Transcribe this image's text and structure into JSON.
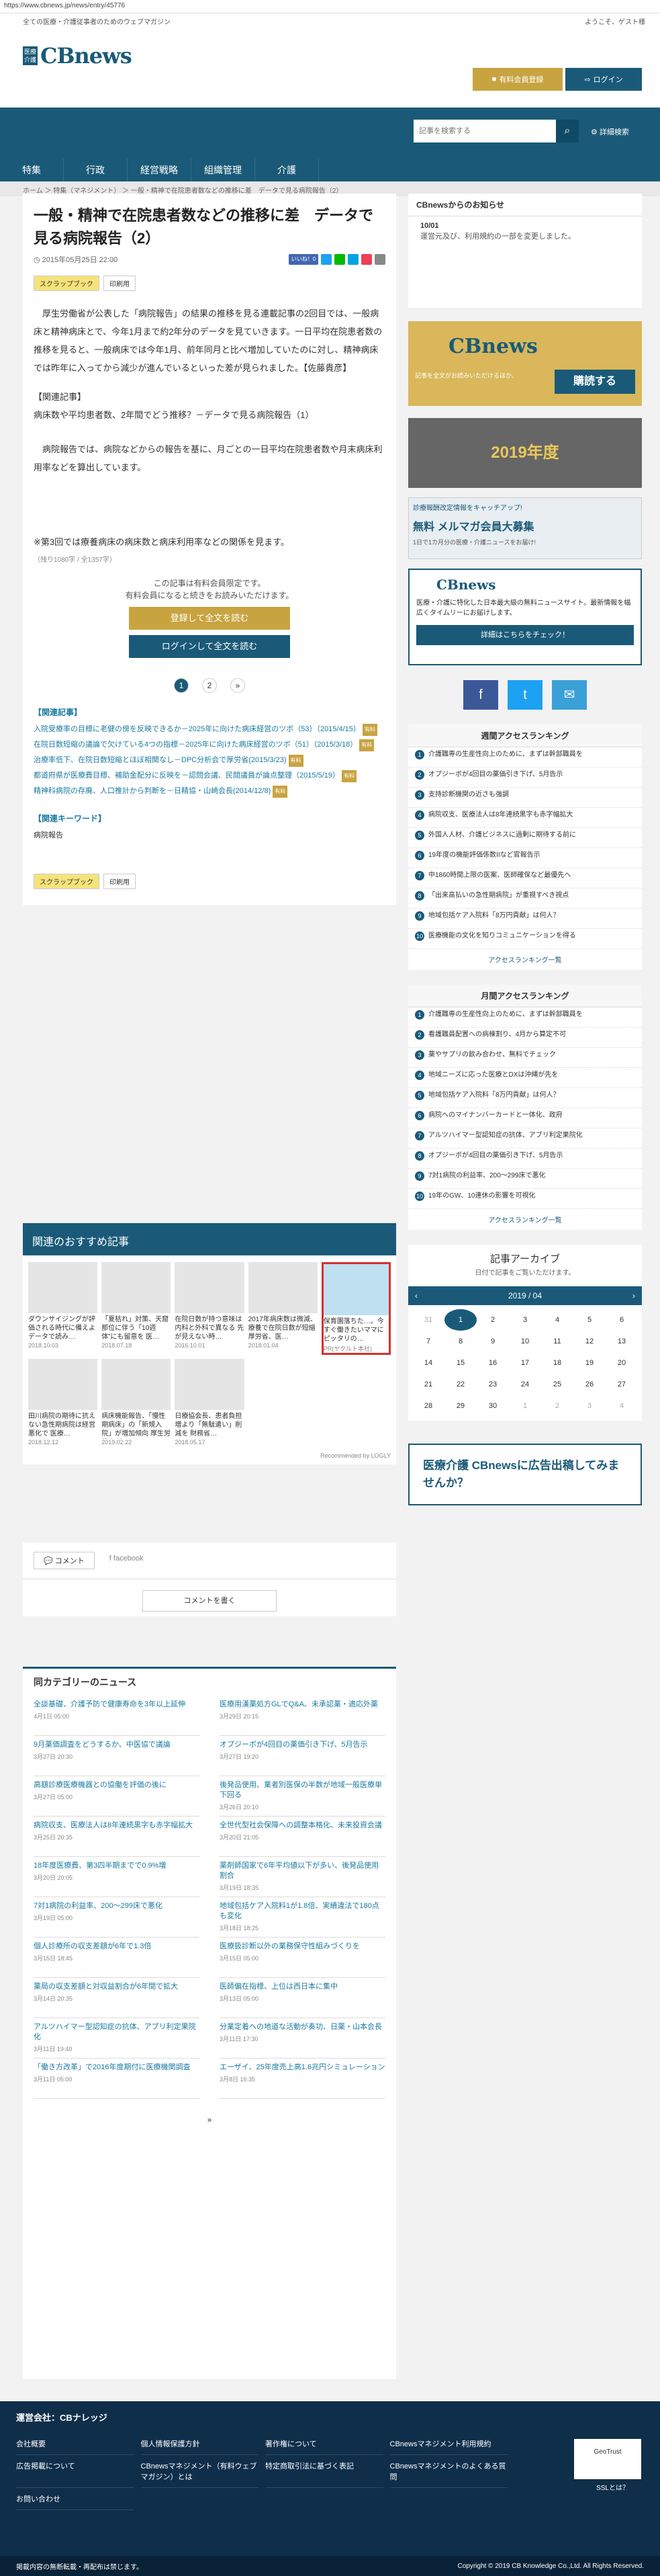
{
  "url": "https://www.cbnews.jp/news/entry/45776",
  "tagline": "全ての医療・介護従事者のためのウェブマガジン",
  "welcome": "ようこそ、ゲスト様",
  "logo": {
    "kanji": "医療介護",
    "cb": "CBnews",
    "mag": "マネジメント"
  },
  "header": {
    "register": "有料会員登録",
    "login": "ログイン"
  },
  "search": {
    "placeholder": "記事を検索する",
    "advanced": "詳細検索"
  },
  "nav": [
    "特集",
    "行政",
    "経営戦略",
    "組織管理",
    "介護"
  ],
  "breadcrumb": "ホーム ＞ 特集（マネジメント） ＞ 一般・精神で在院患者数などの推移に差　データで見る病院報告（2）",
  "article": {
    "title": "一般・精神で在院患者数などの推移に差　データで見る病院報告（2）",
    "date": "2015年05月25日 22:00",
    "like": "いいね！0",
    "scrap": "スクラップブック",
    "print": "印刷用",
    "p1": "厚生労働省が公表した「病院報告」の結果の推移を見る連載記事の2回目では、一般病床と精神病床とで、今年1月まで約2年分のデータを見ていきます。一日平均在院患者数の推移を見ると、一般病床では今年1月、前年同月と比べ増加していたのに対し、精神病床では昨年に入ってから減少が進んでいるといった差が見られました。【佐藤貴彦】",
    "related_head": "【関連記事】",
    "related_link": "病床数や平均患者数、2年間でどう推移？－データで見る病院報告（1）",
    "p2": "病院報告では、病院などからの報告を基に、月ごとの一日平均在院患者数や月末病床利用率などを算出しています。",
    "p3": "※第3回では療養病床の病床数と病床利用率などの関係を見ます。",
    "charcount": "（残り1080字 / 全1357字）",
    "paywall1": "この記事は有料会員限定です。",
    "paywall2": "有料会員になると続きをお読みいただけます。",
    "btn_register": "登録して全文を読む",
    "btn_login": "ログインして全文を読む",
    "pages": [
      "1",
      "2",
      "»"
    ],
    "kanren_head": "【関連記事】",
    "kanren": [
      "入院受療率の目標に老健の傍を反映できるか－2025年に向けた病床経営のツボ（53）（2015/4/15）",
      "在院日数短縮の議論で欠けている4つの指標－2025年に向けた病床経営のツボ（51）（2015/3/18）",
      "治療率低下、在院日数短縮とほぼ相関なし－DPC分析会で厚労省(2015/3/23)",
      "都道府県が医療費目標、補助金配分に反映を－認問会議、民間議員が論点整理（2015/5/19）",
      "精神科病院の存廃、人口推計から判断を－日精協・山崎会長(2014/12/8)"
    ],
    "kw_head": "【関連キーワード】",
    "kw": "病院報告",
    "badge": "有料"
  },
  "recommend": {
    "head": "関連のおすすめ記事",
    "cards": [
      {
        "cap": "ダウンサイジングが評価される時代に備えよ データで読み…",
        "date": "2018.10.03"
      },
      {
        "cap": "「夏枯れ」対策、天窟那位に伴う「10週体”にも留意を 医…",
        "date": "2018.07.18"
      },
      {
        "cap": "在院日数が持つ意味は内科と外科で異なる 先が見えない時…",
        "date": "2016.10.01"
      },
      {
        "cap": "2017年病床数は微減、療養で在院日数が短縮 厚労省、医…",
        "date": "2018.01.04"
      },
      {
        "cap": "保育園落ちた…。今すぐ働きたいママにピッタリの…",
        "date": "PR(ヤクルト本社)"
      },
      {
        "cap": "田川病院の期待に抗えない急性期病院は経営悪化で 医療…",
        "date": "2018.12.12"
      },
      {
        "cap": "病床機能報告、「慢性期病床」の「新規入院」が増加傾向 厚生労働省が…",
        "date": "2019.02.22"
      },
      {
        "cap": "日療協会長、患者負担増より「無駄遣い」削減を 財務省…",
        "date": "2018.05.17"
      },
      {
        "cap": "",
        "date": ""
      },
      {
        "cap": "",
        "date": ""
      }
    ],
    "powered": "Recommended by LOGLY"
  },
  "comments": {
    "tab1": "コメント",
    "tab2": "facebook",
    "btn": "コメントを書く"
  },
  "category": {
    "head": "同カテゴリーのニュース",
    "items": [
      {
        "t": "全談基礎、介護予防で健康寿命を3年以上延伸",
        "d": "4月1日 05:00"
      },
      {
        "t": "医療用漢薬処方GLでQ&A、未承認薬・適応外薬",
        "d": "3月29日 20:15"
      },
      {
        "t": "9月薬価調査をどうするか、中医協で議論",
        "d": "3月27日 20:30"
      },
      {
        "t": "オプジーボが4回目の薬価引き下げ、5月告示",
        "d": "3月27日 19:20"
      },
      {
        "t": "高額診療医療機器との協働を評価の後に",
        "d": "3月27日 05:00"
      },
      {
        "t": "後発品使用、業者別医保の半数が地域一般医療単下回る",
        "d": "3月26日 20:10"
      },
      {
        "t": "病院収支、医療法人は8年連続黒字も赤字幅拡大",
        "d": "3月25日 20:35"
      },
      {
        "t": "全世代型社会保障への調整本格化、未来投資会議",
        "d": "3月20日 21:05"
      },
      {
        "t": "18年度医療費、第3四半期までで0.9%増",
        "d": "3月20日 20:05"
      },
      {
        "t": "薬剤師国家で6年平均値以下が多い、後発品使用割合",
        "d": "3月19日 18:35"
      },
      {
        "t": "7対1病院の利益率、200～299床で悪化",
        "d": "3月19日 05:00"
      },
      {
        "t": "地域包括ケア入院料1が1.8倍、実績違法で180点も変化",
        "d": "3月18日 18:25"
      },
      {
        "t": "個人診療所の収支差額が6年で1.3倍",
        "d": "3月15日 18:45"
      },
      {
        "t": "医療扱診断以外の業務保守性組みづくりを",
        "d": "3月15日 05:00"
      },
      {
        "t": "薬局の収支差額と対収益割合が6年間で拡大",
        "d": "3月14日 20:35"
      },
      {
        "t": "医師偏在指標、上位は西日本に集中",
        "d": "3月13日 05:00"
      },
      {
        "t": "アルツハイマー型認知症の抗体、アブリ利定果院化",
        "d": "3月11日 19:40"
      },
      {
        "t": "分業定着への地道な活動が奏功、日薬・山本会長",
        "d": "3月11日 17:30"
      },
      {
        "t": "「働き方改革」で2016年度期付に医療機関調査",
        "d": "3月11日 05:00"
      },
      {
        "t": "エーザイ、25年度売上高1.6兆円シミュレーション",
        "d": "3月8日 16:35"
      }
    ],
    "page": "»"
  },
  "side": {
    "notice_head": "CBnewsからのお知らせ",
    "notice_date": "10/01",
    "notice_text": "運営元及び、利用規約の一部を変更しました。",
    "banner1_line1": "記事を全文がお読みいただけるほか、",
    "banner1_btn": "購読する",
    "banner2": "2019年度",
    "banner3_head": "診療報酬改定情報をキャッチアップ!",
    "banner3_main": "無料 メルマガ会員大募集",
    "banner3_sub": "1日で1カ月分の医療・介護ニュースをお届け!",
    "about_line": "医療・介護に特化した日本最大級の無料ニュースサイト。最新情報を幅広くタイムリーにお届けします。",
    "about_btn": "詳細はこちらをチェック！",
    "weekly_head": "週間アクセスランキング",
    "weekly": [
      "介護職専の生産性向上のために、まずは幹部職員を",
      "オプジーボが4回目の薬価引き下げ、5月告示",
      "支持診断機関の近さも強調",
      "病院収支、医療法人は8年連続黒字も赤字幅拡大",
      "外国人人材、介護ビジネスに過剰に期待する前に",
      "19年度の機能評価係数IIなど官報告示",
      "中1860時間上限の医案、医師確保など最優先へ",
      "「出来高払いの急性期病院」が重視すべき視点",
      "地域包括ケア入院料「8万円貢献」は何人？",
      "医療機能の文化を知りコミュニケーションを得る"
    ],
    "monthly_head": "月間アクセスランキング",
    "monthly": [
      "介護職専の生産性向上のために、まずは幹部職員を",
      "看護職員配置への病棟割り、4月から算定不可",
      "薬やサプリの飲み合わせ、無料でチェック",
      "地域ニーズに応った医療とDXは沖縄が先を",
      "地域包括ケア入院料「8万円貢献」は何人？",
      "病院へのマイナンバーカードと一体化、政府",
      "アルツハイマー型認知症の抗体、アブリ利定果院化",
      "オプジーボが4回目の薬価引き下げ、5月告示",
      "7対1病院の利益率、200～299床で悪化",
      "19年のGW、10連休の影響を可視化"
    ],
    "more": "アクセスランキング一覧",
    "archive_head": "記事アーカイブ",
    "archive_sub": "日付で記事をご覧いただけます。",
    "cal_month": "2019 / 04",
    "cal_days": [
      "31",
      "1",
      "2",
      "3",
      "4",
      "5",
      "6",
      "7",
      "8",
      "9",
      "10",
      "11",
      "12",
      "13",
      "14",
      "15",
      "16",
      "17",
      "18",
      "19",
      "20",
      "21",
      "22",
      "23",
      "24",
      "25",
      "26",
      "27",
      "28",
      "29",
      "30",
      "1",
      "2",
      "3",
      "4"
    ],
    "adbox": "医療介護 CBnewsに広告出稿してみませんか？"
  },
  "footer": {
    "head": "運営会社：CBナレッジ",
    "links": [
      "会社概要",
      "個人情報保護方針",
      "著作権について",
      "CBnewsマネジメント利用規約",
      "広告掲載について",
      "CBnewsマネジメント（有料ウェブマガジン）とは",
      "特定商取引法に基づく表記",
      "CBnewsマネジメントのよくある質問",
      "お問い合わせ"
    ],
    "ssl": "SSLとは？",
    "left": "掲載内容の無断転載・再配布は禁じます。",
    "copy": "Copyright © 2019 CB Knowledge Co.,Ltd. All Rights Reserved."
  },
  "colors": {
    "brand": "#1a5a78",
    "gold": "#c8a440",
    "red": "#d83030"
  }
}
